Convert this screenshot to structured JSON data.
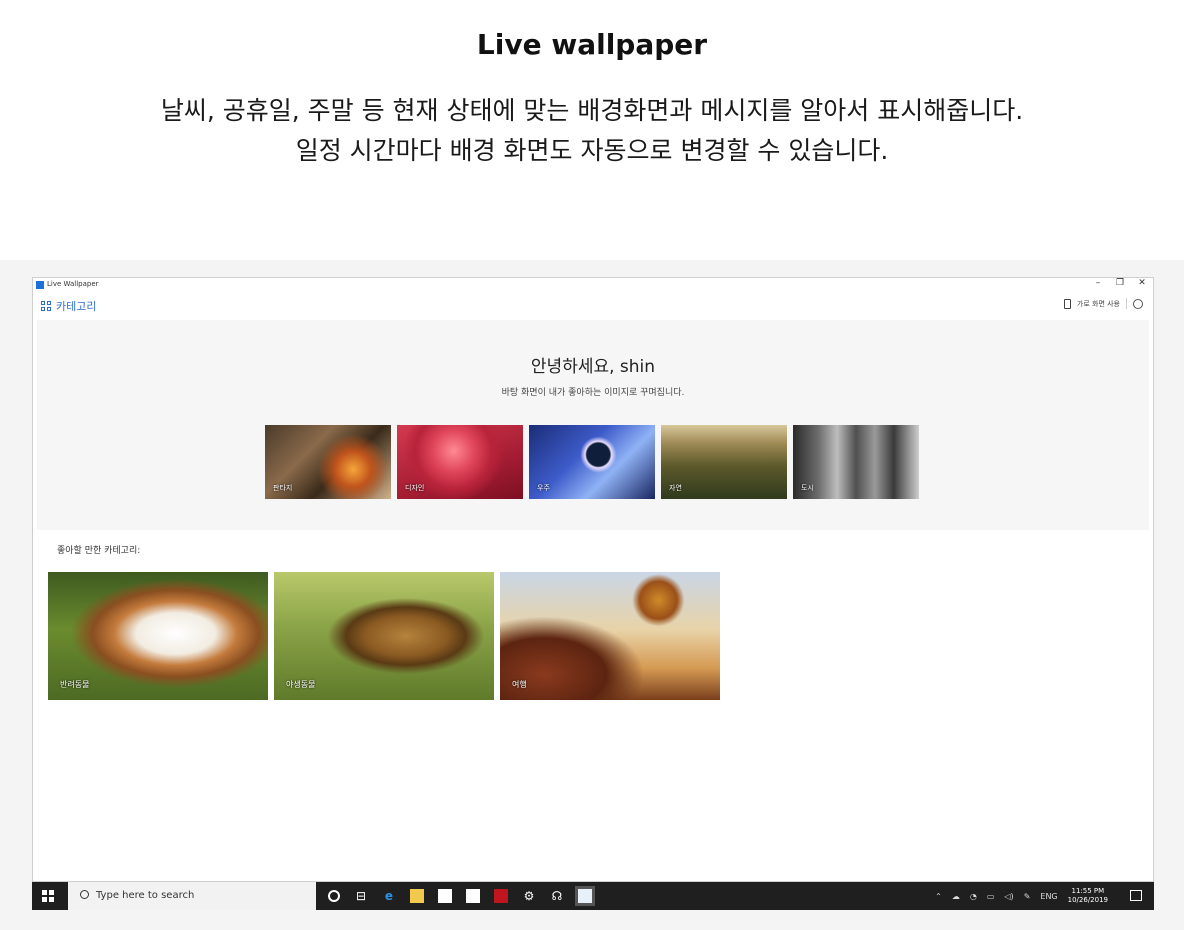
{
  "header": {
    "title": "Live wallpaper",
    "desc_line1": "날씨, 공휴일, 주말 등 현재 상태에 맞는 배경화면과 메시지를 알아서 표시해줍니다.",
    "desc_line2": "일정 시간마다 배경 화면도 자동으로 변경할 수 있습니다."
  },
  "window": {
    "title": "Live Wallpaper",
    "controls": {
      "minimize": "–",
      "maximize": "❐",
      "close": "✕"
    }
  },
  "nav": {
    "category_label": "카테고리"
  },
  "tools": {
    "phone_label": "가로 화면 사용"
  },
  "hero": {
    "greeting": "안녕하세요, shin",
    "subtitle": "바탕 화면이 내가 좋아하는 이미지로 꾸며집니다.",
    "thumbnails": [
      {
        "label": "판타지"
      },
      {
        "label": "디자인"
      },
      {
        "label": "우주"
      },
      {
        "label": "자연"
      },
      {
        "label": "도시"
      }
    ]
  },
  "recommend": {
    "heading": "좋아할 만한 카테고리:",
    "cards": [
      {
        "label": "반려동물"
      },
      {
        "label": "야생동물"
      },
      {
        "label": "여행"
      }
    ]
  },
  "taskbar": {
    "search_placeholder": "Type here to search",
    "tray_lang": "ENG",
    "clock_time": "11:55 PM",
    "clock_date": "10/26/2019"
  }
}
